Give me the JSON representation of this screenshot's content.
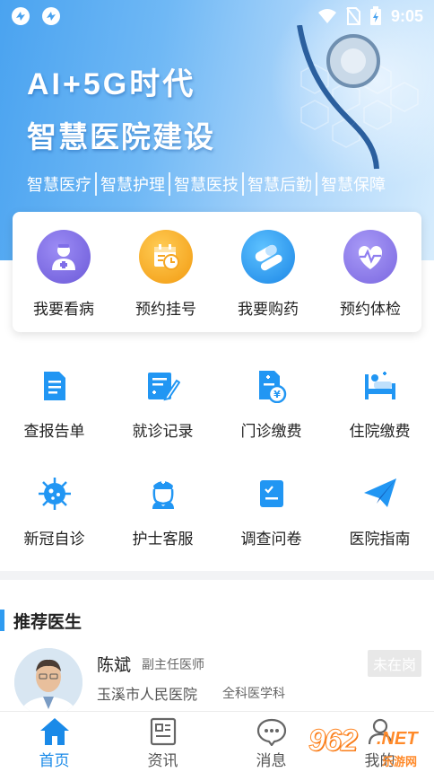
{
  "status_bar": {
    "time": "9:05"
  },
  "banner": {
    "title": "AI+5G时代",
    "subtitle": "智慧医院建设",
    "tags": [
      "智慧医疗",
      "智慧护理",
      "智慧医技",
      "智慧后勤",
      "智慧保障"
    ]
  },
  "quick_actions": [
    {
      "label": "我要看病",
      "icon": "doctor-icon",
      "color": "#7f6ee8"
    },
    {
      "label": "预约挂号",
      "icon": "calendar-clock-icon",
      "color": "#f5a623"
    },
    {
      "label": "我要购药",
      "icon": "pill-icon",
      "color": "#2e9bf0"
    },
    {
      "label": "预约体检",
      "icon": "heart-pulse-icon",
      "color": "#8f7ef0"
    }
  ],
  "services": [
    {
      "label": "查报告单",
      "icon": "report-icon"
    },
    {
      "label": "就诊记录",
      "icon": "record-icon"
    },
    {
      "label": "门诊缴费",
      "icon": "outpatient-payment-icon"
    },
    {
      "label": "住院缴费",
      "icon": "hospital-bed-icon"
    },
    {
      "label": "新冠自诊",
      "icon": "virus-icon"
    },
    {
      "label": "护士客服",
      "icon": "nurse-icon"
    },
    {
      "label": "调查问卷",
      "icon": "survey-icon"
    },
    {
      "label": "医院指南",
      "icon": "paper-plane-icon"
    }
  ],
  "recommend": {
    "title": "推荐医生",
    "doctor": {
      "name": "陈斌",
      "title": "副主任医师",
      "hospital": "玉溪市人民医院",
      "department": "全科医学科",
      "status": "未在岗"
    }
  },
  "tabs": [
    {
      "label": "首页",
      "icon": "home-icon",
      "active": true
    },
    {
      "label": "资讯",
      "icon": "news-icon",
      "active": false
    },
    {
      "label": "消息",
      "icon": "message-icon",
      "active": false
    },
    {
      "label": "我的",
      "icon": "user-icon",
      "active": false
    }
  ],
  "watermark": {
    "number": "962",
    "suffix": ".NET",
    "name": "乐游网"
  },
  "colors": {
    "accent": "#1a8ae8",
    "icon_blue": "#2196f3"
  }
}
